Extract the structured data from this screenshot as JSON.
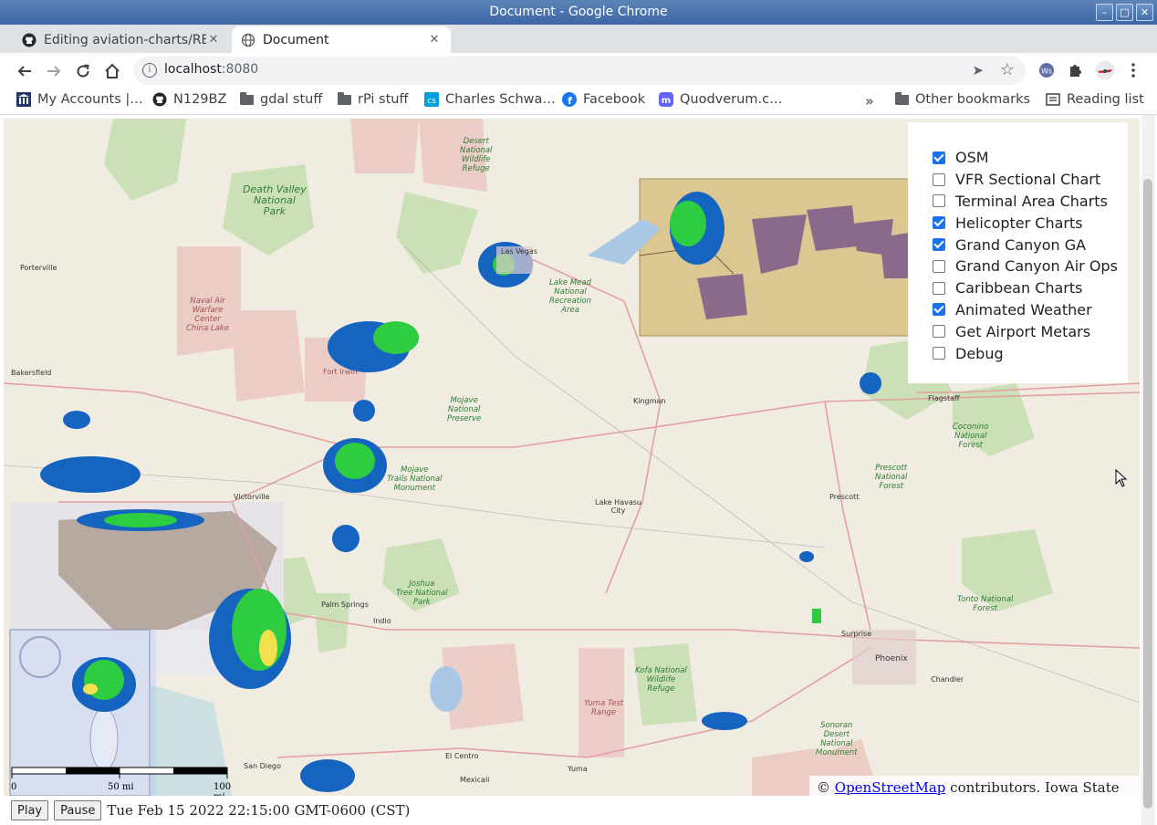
{
  "window": {
    "title": "Document - Google Chrome"
  },
  "tabs": [
    {
      "title": "Editing aviation-charts/RE",
      "favicon": "github-icon",
      "active": false
    },
    {
      "title": "Document",
      "favicon": "globe-icon",
      "active": true
    }
  ],
  "address_bar": {
    "host": "localhost",
    "port": ":8080"
  },
  "bookmarks": [
    {
      "label": "My Accounts |…",
      "icon": "bank-icon"
    },
    {
      "label": "N129BZ",
      "icon": "github-icon"
    },
    {
      "label": "gdal stuff",
      "icon": "folder-icon"
    },
    {
      "label": "rPi stuff",
      "icon": "folder-icon"
    },
    {
      "label": "Charles Schwa…",
      "icon": "schwab-icon"
    },
    {
      "label": "Facebook",
      "icon": "facebook-icon"
    },
    {
      "label": "Quodverum.c…",
      "icon": "mastodon-icon"
    }
  ],
  "bookmarks_overflow": "»",
  "other_bookmarks": "Other bookmarks",
  "reading_list": "Reading list",
  "layers": [
    {
      "label": "OSM",
      "checked": true
    },
    {
      "label": "VFR Sectional Chart",
      "checked": false
    },
    {
      "label": "Terminal Area Charts",
      "checked": false
    },
    {
      "label": "Helicopter Charts",
      "checked": true
    },
    {
      "label": "Grand Canyon GA",
      "checked": true
    },
    {
      "label": "Grand Canyon Air Ops",
      "checked": false
    },
    {
      "label": "Caribbean Charts",
      "checked": false
    },
    {
      "label": "Animated Weather",
      "checked": true
    },
    {
      "label": "Get Airport Metars",
      "checked": false
    },
    {
      "label": "Debug",
      "checked": false
    }
  ],
  "map_labels": {
    "death_valley": "Death Valley\nNational\nPark",
    "naval_air": "Naval Air\nWarfare\nCenter\nChina Lake",
    "mojave_preserve": "Mojave\nNational\nPreserve",
    "mojave_trails": "Mojave\nTrails National\nMonument",
    "joshua_tree": "Joshua\nTree National\nPark",
    "lake_mead": "Lake Mead\nNational\nRecreation\nArea",
    "coconino": "Coconino\nNational\nForest",
    "prescott": "Prescott\nNational\nForest",
    "tonto": "Tonto National\nForest",
    "desert_refuge": "Desert\nNational\nWildlife\nRefuge",
    "sonoran": "Sonoran\nDesert\nNational\nMonument",
    "yuma_range": "Yuma Test\nRange",
    "kofa": "Kofa National\nWildlife\nRefuge",
    "fort_irwin": "Fort Irwin",
    "las_vegas": "Las Vegas",
    "kingman": "Kingman",
    "lake_havasu": "Lake Havasu\nCity",
    "phoenix": "Phoenix",
    "bakersfield": "Bakersfield",
    "victorville": "Victorville",
    "palm_springs": "Palm Springs",
    "indio": "Indio",
    "prescott_town": "Prescott",
    "flagstaff": "Flagstaff",
    "el_centro": "El Centro",
    "mexicali": "Mexicali",
    "yuma": "Yuma",
    "san_diego": "San Diego",
    "chandler": "Chandler",
    "surprise": "Surprise",
    "porterville": "Porterville"
  },
  "scale": {
    "zero": "0",
    "mid": "50 mi",
    "max": "100 mi"
  },
  "attribution": {
    "prefix": "©",
    "link": "OpenStreetMap",
    "suffix": "contributors. Iowa State University"
  },
  "controls": {
    "play": "Play",
    "pause": "Pause",
    "timestamp": "Tue Feb 15 2022 22:15:00 GMT-0600 (CST)"
  }
}
